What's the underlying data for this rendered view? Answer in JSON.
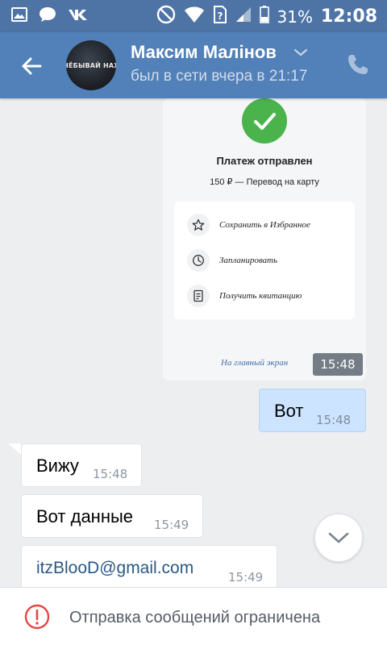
{
  "status_bar": {
    "battery": "31%",
    "time": "12:08",
    "icons": [
      "gallery-icon",
      "chat-icon",
      "vk-icon",
      "dnd-icon",
      "wifi-icon",
      "sim-icon",
      "signal-icon",
      "battery-icon"
    ]
  },
  "header": {
    "name": "Максим Малінов",
    "status": "был в сети вчера в 21:17",
    "avatar_text": "ЧЁБЫВАЙ НАХ"
  },
  "payment_card": {
    "title": "Платеж отправлен",
    "subtitle": "150 ₽ — Перевод на карту",
    "actions": [
      {
        "label": "Сохранить в Избранное",
        "icon": "star-icon"
      },
      {
        "label": "Запланировать",
        "icon": "clock-icon"
      },
      {
        "label": "Получить квитанцию",
        "icon": "receipt-icon"
      }
    ],
    "link": "На главный экран",
    "time": "15:48"
  },
  "messages": [
    {
      "direction": "out",
      "text": "Вот",
      "time": "15:48"
    },
    {
      "direction": "in",
      "text": "Вижу",
      "time": "15:48"
    },
    {
      "direction": "in",
      "text": "Вот данные",
      "time": "15:49"
    },
    {
      "direction": "in",
      "text": "itzBlooD@gmail.com",
      "time": "15:49"
    }
  ],
  "bottom_bar": {
    "notice": "Отправка сообщений ограничена"
  },
  "colors": {
    "header": "#5181b8",
    "statusbar": "#4e74a6",
    "out_bubble": "#cce4ff",
    "check_green": "#4bb34b",
    "warning_red": "#e64646"
  }
}
